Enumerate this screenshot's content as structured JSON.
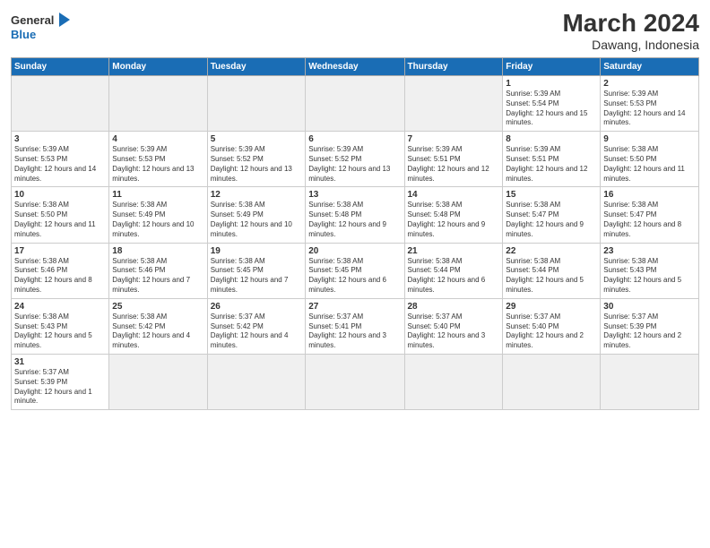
{
  "logo": {
    "text_general": "General",
    "text_blue": "Blue"
  },
  "header": {
    "month": "March 2024",
    "location": "Dawang, Indonesia"
  },
  "weekdays": [
    "Sunday",
    "Monday",
    "Tuesday",
    "Wednesday",
    "Thursday",
    "Friday",
    "Saturday"
  ],
  "weeks": [
    [
      {
        "day": "",
        "info": ""
      },
      {
        "day": "",
        "info": ""
      },
      {
        "day": "",
        "info": ""
      },
      {
        "day": "",
        "info": ""
      },
      {
        "day": "",
        "info": ""
      },
      {
        "day": "1",
        "info": "Sunrise: 5:39 AM\nSunset: 5:54 PM\nDaylight: 12 hours and 15 minutes."
      },
      {
        "day": "2",
        "info": "Sunrise: 5:39 AM\nSunset: 5:53 PM\nDaylight: 12 hours and 14 minutes."
      }
    ],
    [
      {
        "day": "3",
        "info": "Sunrise: 5:39 AM\nSunset: 5:53 PM\nDaylight: 12 hours and 14 minutes."
      },
      {
        "day": "4",
        "info": "Sunrise: 5:39 AM\nSunset: 5:53 PM\nDaylight: 12 hours and 13 minutes."
      },
      {
        "day": "5",
        "info": "Sunrise: 5:39 AM\nSunset: 5:52 PM\nDaylight: 12 hours and 13 minutes."
      },
      {
        "day": "6",
        "info": "Sunrise: 5:39 AM\nSunset: 5:52 PM\nDaylight: 12 hours and 13 minutes."
      },
      {
        "day": "7",
        "info": "Sunrise: 5:39 AM\nSunset: 5:51 PM\nDaylight: 12 hours and 12 minutes."
      },
      {
        "day": "8",
        "info": "Sunrise: 5:39 AM\nSunset: 5:51 PM\nDaylight: 12 hours and 12 minutes."
      },
      {
        "day": "9",
        "info": "Sunrise: 5:38 AM\nSunset: 5:50 PM\nDaylight: 12 hours and 11 minutes."
      }
    ],
    [
      {
        "day": "10",
        "info": "Sunrise: 5:38 AM\nSunset: 5:50 PM\nDaylight: 12 hours and 11 minutes."
      },
      {
        "day": "11",
        "info": "Sunrise: 5:38 AM\nSunset: 5:49 PM\nDaylight: 12 hours and 10 minutes."
      },
      {
        "day": "12",
        "info": "Sunrise: 5:38 AM\nSunset: 5:49 PM\nDaylight: 12 hours and 10 minutes."
      },
      {
        "day": "13",
        "info": "Sunrise: 5:38 AM\nSunset: 5:48 PM\nDaylight: 12 hours and 9 minutes."
      },
      {
        "day": "14",
        "info": "Sunrise: 5:38 AM\nSunset: 5:48 PM\nDaylight: 12 hours and 9 minutes."
      },
      {
        "day": "15",
        "info": "Sunrise: 5:38 AM\nSunset: 5:47 PM\nDaylight: 12 hours and 9 minutes."
      },
      {
        "day": "16",
        "info": "Sunrise: 5:38 AM\nSunset: 5:47 PM\nDaylight: 12 hours and 8 minutes."
      }
    ],
    [
      {
        "day": "17",
        "info": "Sunrise: 5:38 AM\nSunset: 5:46 PM\nDaylight: 12 hours and 8 minutes."
      },
      {
        "day": "18",
        "info": "Sunrise: 5:38 AM\nSunset: 5:46 PM\nDaylight: 12 hours and 7 minutes."
      },
      {
        "day": "19",
        "info": "Sunrise: 5:38 AM\nSunset: 5:45 PM\nDaylight: 12 hours and 7 minutes."
      },
      {
        "day": "20",
        "info": "Sunrise: 5:38 AM\nSunset: 5:45 PM\nDaylight: 12 hours and 6 minutes."
      },
      {
        "day": "21",
        "info": "Sunrise: 5:38 AM\nSunset: 5:44 PM\nDaylight: 12 hours and 6 minutes."
      },
      {
        "day": "22",
        "info": "Sunrise: 5:38 AM\nSunset: 5:44 PM\nDaylight: 12 hours and 5 minutes."
      },
      {
        "day": "23",
        "info": "Sunrise: 5:38 AM\nSunset: 5:43 PM\nDaylight: 12 hours and 5 minutes."
      }
    ],
    [
      {
        "day": "24",
        "info": "Sunrise: 5:38 AM\nSunset: 5:43 PM\nDaylight: 12 hours and 5 minutes."
      },
      {
        "day": "25",
        "info": "Sunrise: 5:38 AM\nSunset: 5:42 PM\nDaylight: 12 hours and 4 minutes."
      },
      {
        "day": "26",
        "info": "Sunrise: 5:37 AM\nSunset: 5:42 PM\nDaylight: 12 hours and 4 minutes."
      },
      {
        "day": "27",
        "info": "Sunrise: 5:37 AM\nSunset: 5:41 PM\nDaylight: 12 hours and 3 minutes."
      },
      {
        "day": "28",
        "info": "Sunrise: 5:37 AM\nSunset: 5:40 PM\nDaylight: 12 hours and 3 minutes."
      },
      {
        "day": "29",
        "info": "Sunrise: 5:37 AM\nSunset: 5:40 PM\nDaylight: 12 hours and 2 minutes."
      },
      {
        "day": "30",
        "info": "Sunrise: 5:37 AM\nSunset: 5:39 PM\nDaylight: 12 hours and 2 minutes."
      }
    ],
    [
      {
        "day": "31",
        "info": "Sunrise: 5:37 AM\nSunset: 5:39 PM\nDaylight: 12 hours and 1 minute."
      },
      {
        "day": "",
        "info": ""
      },
      {
        "day": "",
        "info": ""
      },
      {
        "day": "",
        "info": ""
      },
      {
        "day": "",
        "info": ""
      },
      {
        "day": "",
        "info": ""
      },
      {
        "day": "",
        "info": ""
      }
    ]
  ]
}
